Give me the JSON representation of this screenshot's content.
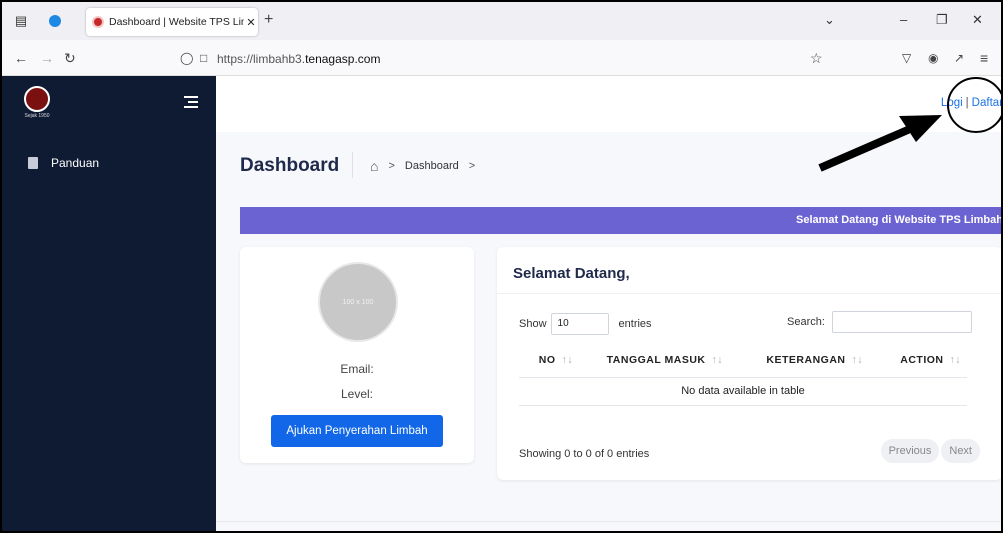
{
  "browser": {
    "tab_title": "Dashboard | Website TPS Limba",
    "url_prefix": "https://limbahb3.",
    "url_domain": "tenagasp.com"
  },
  "sidebar": {
    "logo_tagline": "Sejak 1950",
    "items": [
      {
        "label": "Panduan",
        "icon": "book-icon"
      }
    ]
  },
  "header": {
    "login": "Logi",
    "separator": "|",
    "register": "Daftar"
  },
  "page": {
    "title": "Dashboard",
    "breadcrumb": "Dashboard"
  },
  "banner": {
    "text": "Selamat Datang di Website TPS Limbah"
  },
  "profile": {
    "avatar_placeholder": "100 x 100",
    "email_label": "Email:",
    "level_label": "Level:",
    "submit_button": "Ajukan Penyerahan Limbah"
  },
  "table_card": {
    "title": "Selamat Datang,",
    "show_label": "Show",
    "show_value": "10",
    "entries_label": "entries",
    "search_label": "Search:",
    "columns": [
      "NO",
      "TANGGAL MASUK",
      "KETERANGAN",
      "ACTION"
    ],
    "sort_glyph": "↑↓",
    "empty_message": "No data available in table",
    "info": "Showing 0 to 0 of 0 entries",
    "prev": "Previous",
    "next": "Next"
  },
  "colors": {
    "sidebar": "#0e1b33",
    "banner": "#6b63d1",
    "primary_button": "#1167e8",
    "link": "#1a73e8"
  }
}
